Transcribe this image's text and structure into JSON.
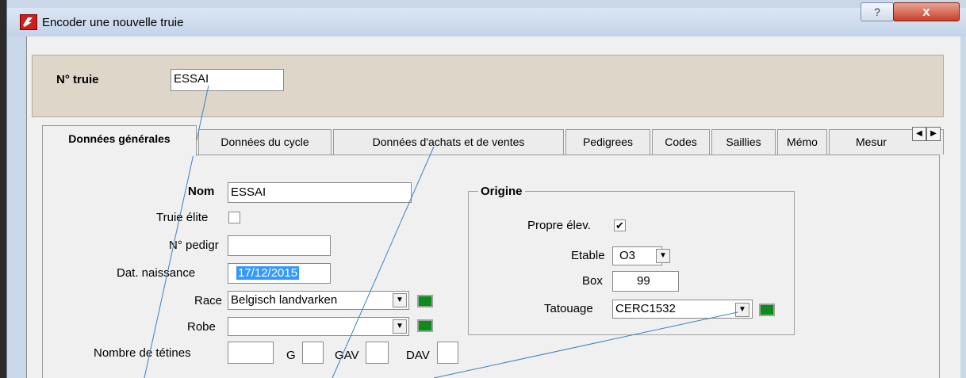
{
  "window": {
    "title": "Encoder une nouvelle truie",
    "help_label": "?",
    "close_label": "x"
  },
  "truie": {
    "label": "N° truie",
    "value": "ESSAI"
  },
  "tabs": [
    {
      "label": "Données générales"
    },
    {
      "label": "Données du cycle"
    },
    {
      "label": "Données d'achats et de ventes"
    },
    {
      "label": "Pedigrees"
    },
    {
      "label": "Codes"
    },
    {
      "label": "Saillies"
    },
    {
      "label": "Mémo"
    },
    {
      "label": "Mesur"
    }
  ],
  "general": {
    "nom": {
      "label": "Nom",
      "value": "ESSAI"
    },
    "truie_elite": {
      "label": "Truie élite",
      "checked": false
    },
    "pedigr": {
      "label": "N° pedigr",
      "value": ""
    },
    "naissance": {
      "label": "Dat. naissance",
      "value": "17/12/2015"
    },
    "race": {
      "label": "Race",
      "value": "Belgisch landvarken"
    },
    "robe": {
      "label": "Robe",
      "value": ""
    },
    "tetines": {
      "label": "Nombre de tétines",
      "g_label": "G",
      "gav_label": "GAV",
      "dav_label": "DAV"
    }
  },
  "origine": {
    "title": "Origine",
    "propre": {
      "label": "Propre élev.",
      "checked": true,
      "mark": "✔"
    },
    "etable": {
      "label": "Etable",
      "value": "O3"
    },
    "box": {
      "label": "Box",
      "value": "99"
    },
    "tatouage": {
      "label": "Tatouage",
      "value": "CERC1532"
    }
  },
  "icons": {
    "dropdown": "▼",
    "scroll_left": "◀",
    "scroll_right": "▶"
  },
  "colors": {
    "green_swatch": "#0f8a1c",
    "selection": "#3399ff",
    "annotation_line": "#3f7fbf"
  }
}
